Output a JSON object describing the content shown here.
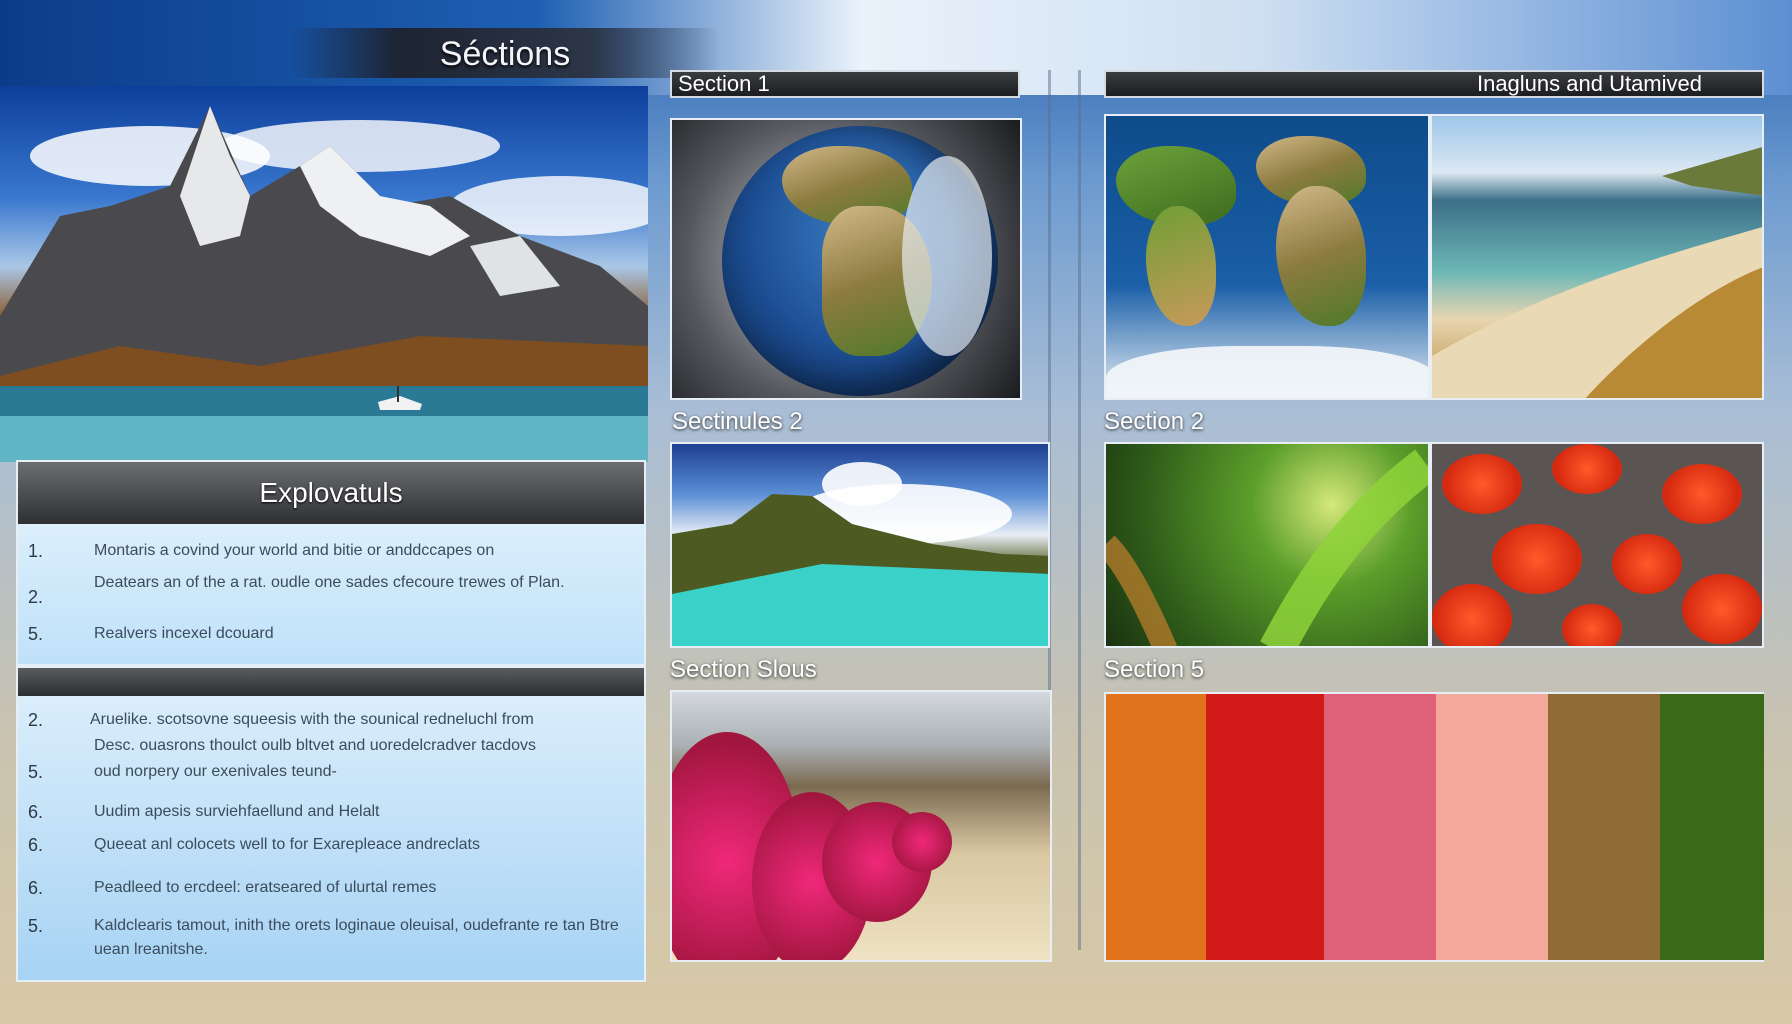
{
  "header": {
    "title": "Séctions"
  },
  "explore_panel": {
    "title": "Explovatuls",
    "items": [
      {
        "num": "1.",
        "text": "Montaris a covind your world and bitie or anddccapes on"
      },
      {
        "num": "2.",
        "text": "Deatears an of the a rat. oudle one sades cfecoure trewes of Plan."
      },
      {
        "num": "5.",
        "text": "Realvers incexel dcouard"
      }
    ]
  },
  "notes_panel": {
    "items": [
      {
        "num": "2.",
        "text": "Aruelike. scotsovne squeesis with the sounical redneluchl from"
      },
      {
        "num": "",
        "text": "Desc. ouasrons thoulct oulb bltvet and uoredelcradver tacdovs"
      },
      {
        "num": "5.",
        "text": "oud norpery our exenivales  teund-"
      },
      {
        "num": "6.",
        "text": "Uudim apesis surviehfaellund and Helalt"
      },
      {
        "num": "6.",
        "text": "Queeat anl colocets well to for Exarepleace andreclats"
      },
      {
        "num": "6.",
        "text": "Peadleed to ercdeel: eratseared of ulurtal remes"
      },
      {
        "num": "5.",
        "text": "Kaldclearis tamout, inith the orets loginaue oleuisal, oudefrante re tan Btre uean lreanitshe."
      }
    ]
  },
  "sections": {
    "s1": "Section 1",
    "s2_left": "Sectinules 2",
    "s3_left": "Section Slous",
    "right_header": "Inagluns and Utamived",
    "s2_right": "Section 2",
    "s5_right": "Section 5"
  },
  "swatch_colors": [
    "#e0731c",
    "#d21a18",
    "#e0607a",
    "#f2a89a",
    "#8f6a34",
    "#3a6a18"
  ]
}
